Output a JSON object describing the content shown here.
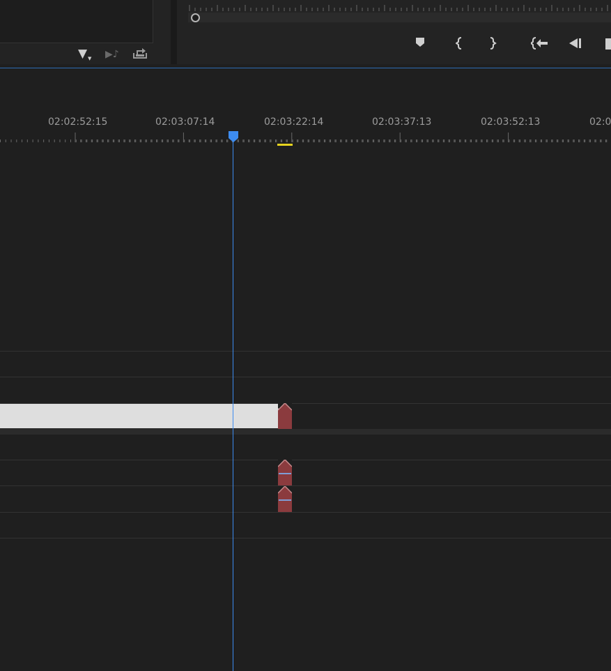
{
  "project_panel": {
    "icons": [
      "filter-icon",
      "automate-to-sequence-icon",
      "export-icon"
    ]
  },
  "program_monitor": {
    "controls": [
      "add-marker-icon",
      "mark-in-icon",
      "mark-out-icon",
      "go-to-in-icon",
      "step-back-icon",
      "play-icon"
    ]
  },
  "timeline": {
    "timecodes": [
      "02:02:52:15",
      "02:03:07:14",
      "02:03:22:14",
      "02:03:37:13",
      "02:03:52:13",
      "02:0"
    ],
    "colors": {
      "playhead": "#3d8cf0",
      "in_out_bar": "#e6d31f",
      "clip_video": "#dedede",
      "clip_transition": "#8b3b3e"
    }
  }
}
